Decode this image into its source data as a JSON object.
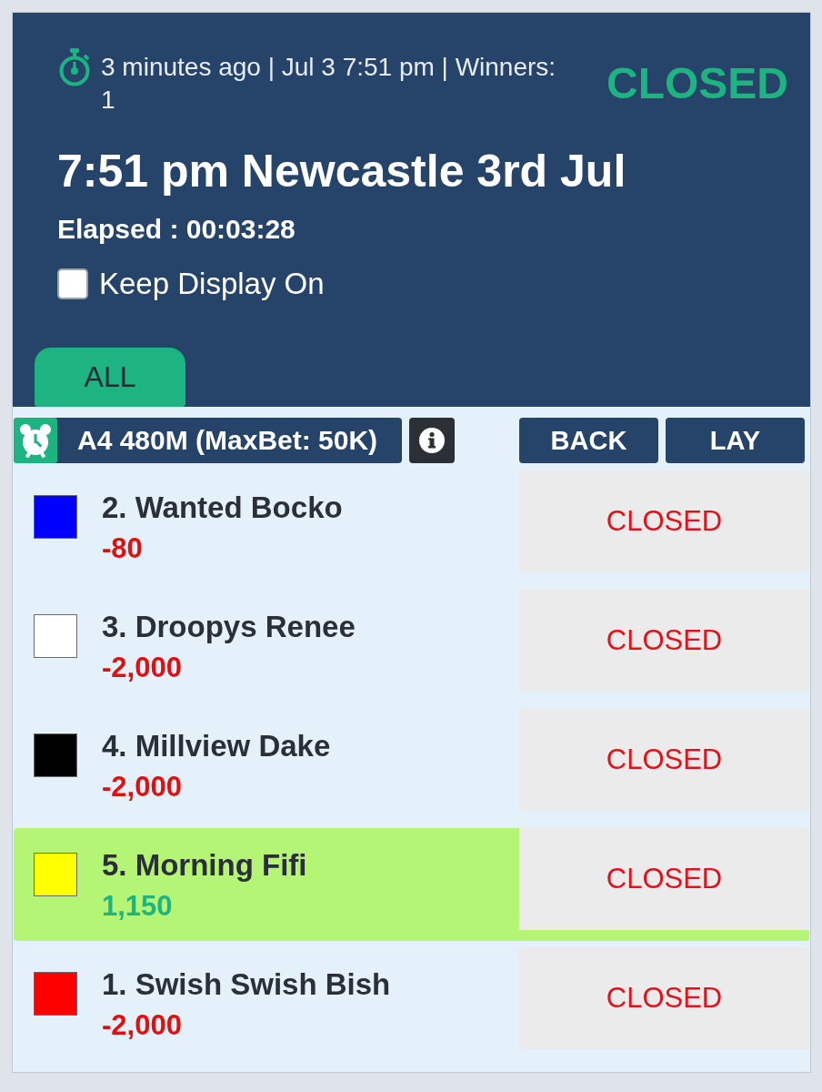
{
  "header": {
    "meta": "3 minutes ago | Jul 3 7:51 pm | Winners: 1",
    "status": "CLOSED",
    "title": "7:51 pm Newcastle 3rd Jul",
    "elapsed": "Elapsed : 00:03:28",
    "keep_display_on": {
      "label": "Keep Display On",
      "checked": false
    }
  },
  "filters": [
    {
      "label": "ALL",
      "selected": true
    }
  ],
  "market": {
    "name": "A4 480M (MaxBet: 50K)"
  },
  "columns": [
    "BACK",
    "LAY"
  ],
  "runners": [
    {
      "name": "2. Wanted Bocko",
      "color": "#0000ff",
      "profit": "-80",
      "profit_positive": false,
      "winner": false,
      "price": "CLOSED"
    },
    {
      "name": "3. Droopys Renee",
      "color": "#ffffff",
      "profit": "-2,000",
      "profit_positive": false,
      "winner": false,
      "price": "CLOSED"
    },
    {
      "name": "4. Millview Dake",
      "color": "#000000",
      "profit": "-2,000",
      "profit_positive": false,
      "winner": false,
      "price": "CLOSED"
    },
    {
      "name": "5. Morning Fifi",
      "color": "#ffff00",
      "profit": "1,150",
      "profit_positive": true,
      "winner": true,
      "price": "CLOSED"
    },
    {
      "name": "1. Swish Swish Bish",
      "color": "#ff0000",
      "profit": "-2,000",
      "profit_positive": false,
      "winner": false,
      "price": "CLOSED"
    }
  ]
}
